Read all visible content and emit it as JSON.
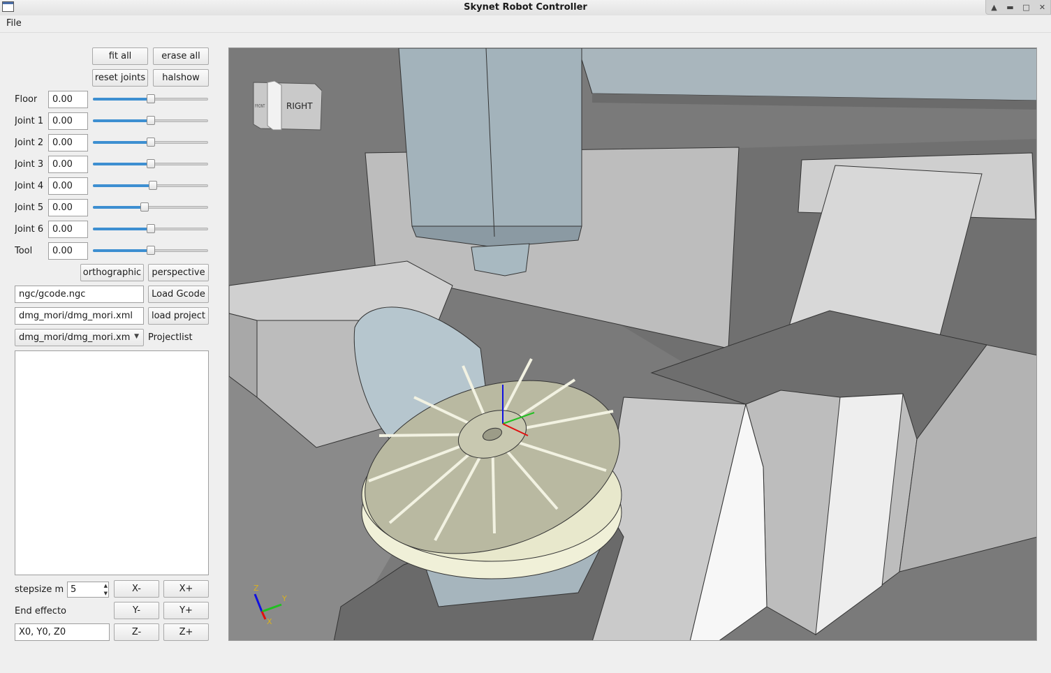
{
  "window": {
    "title": "Skynet Robot Controller"
  },
  "menu": {
    "file": "File"
  },
  "buttons": {
    "fit_all": "fit all",
    "erase_all": "erase all",
    "reset_joints": "reset joints",
    "halshow": "halshow",
    "orthographic": "orthographic",
    "perspective": "perspective",
    "load_gcode": "Load Gcode",
    "load_project": "load project",
    "x_minus": "X-",
    "x_plus": "X+",
    "y_minus": "Y-",
    "y_plus": "Y+",
    "z_minus": "Z-",
    "z_plus": "Z+"
  },
  "joints": [
    {
      "label": "Floor",
      "value": "0.00",
      "slider": 0.5
    },
    {
      "label": "Joint 1",
      "value": "0.00",
      "slider": 0.5
    },
    {
      "label": "Joint 2",
      "value": "0.00",
      "slider": 0.5
    },
    {
      "label": "Joint 3",
      "value": "0.00",
      "slider": 0.5
    },
    {
      "label": "Joint 4",
      "value": "0.00",
      "slider": 0.52
    },
    {
      "label": "Joint 5",
      "value": "0.00",
      "slider": 0.45
    },
    {
      "label": "Joint 6",
      "value": "0.00",
      "slider": 0.5
    },
    {
      "label": "Tool",
      "value": "0.00",
      "slider": 0.5
    }
  ],
  "files": {
    "gcode_path": "ngc/gcode.ngc",
    "project_path": "dmg_mori/dmg_mori.xml",
    "project_select": "dmg_mori/dmg_mori.xm",
    "projectlist_label": "Projectlist"
  },
  "jog": {
    "stepsize_label": "stepsize m",
    "stepsize_value": "5",
    "end_effector_label": "End effecto",
    "position_value": "X0, Y0, Z0"
  },
  "viewport": {
    "viewcube_label": "RIGHT",
    "viewcube_side_label": "FRONT",
    "axis_x": "X",
    "axis_y": "Y",
    "axis_z": "Z"
  },
  "colors": {
    "slider_fill": "#3d8fd1",
    "axis_x": "#e01010",
    "axis_y": "#20c020",
    "axis_z": "#1010e0",
    "axis_label": "#d8b020"
  }
}
